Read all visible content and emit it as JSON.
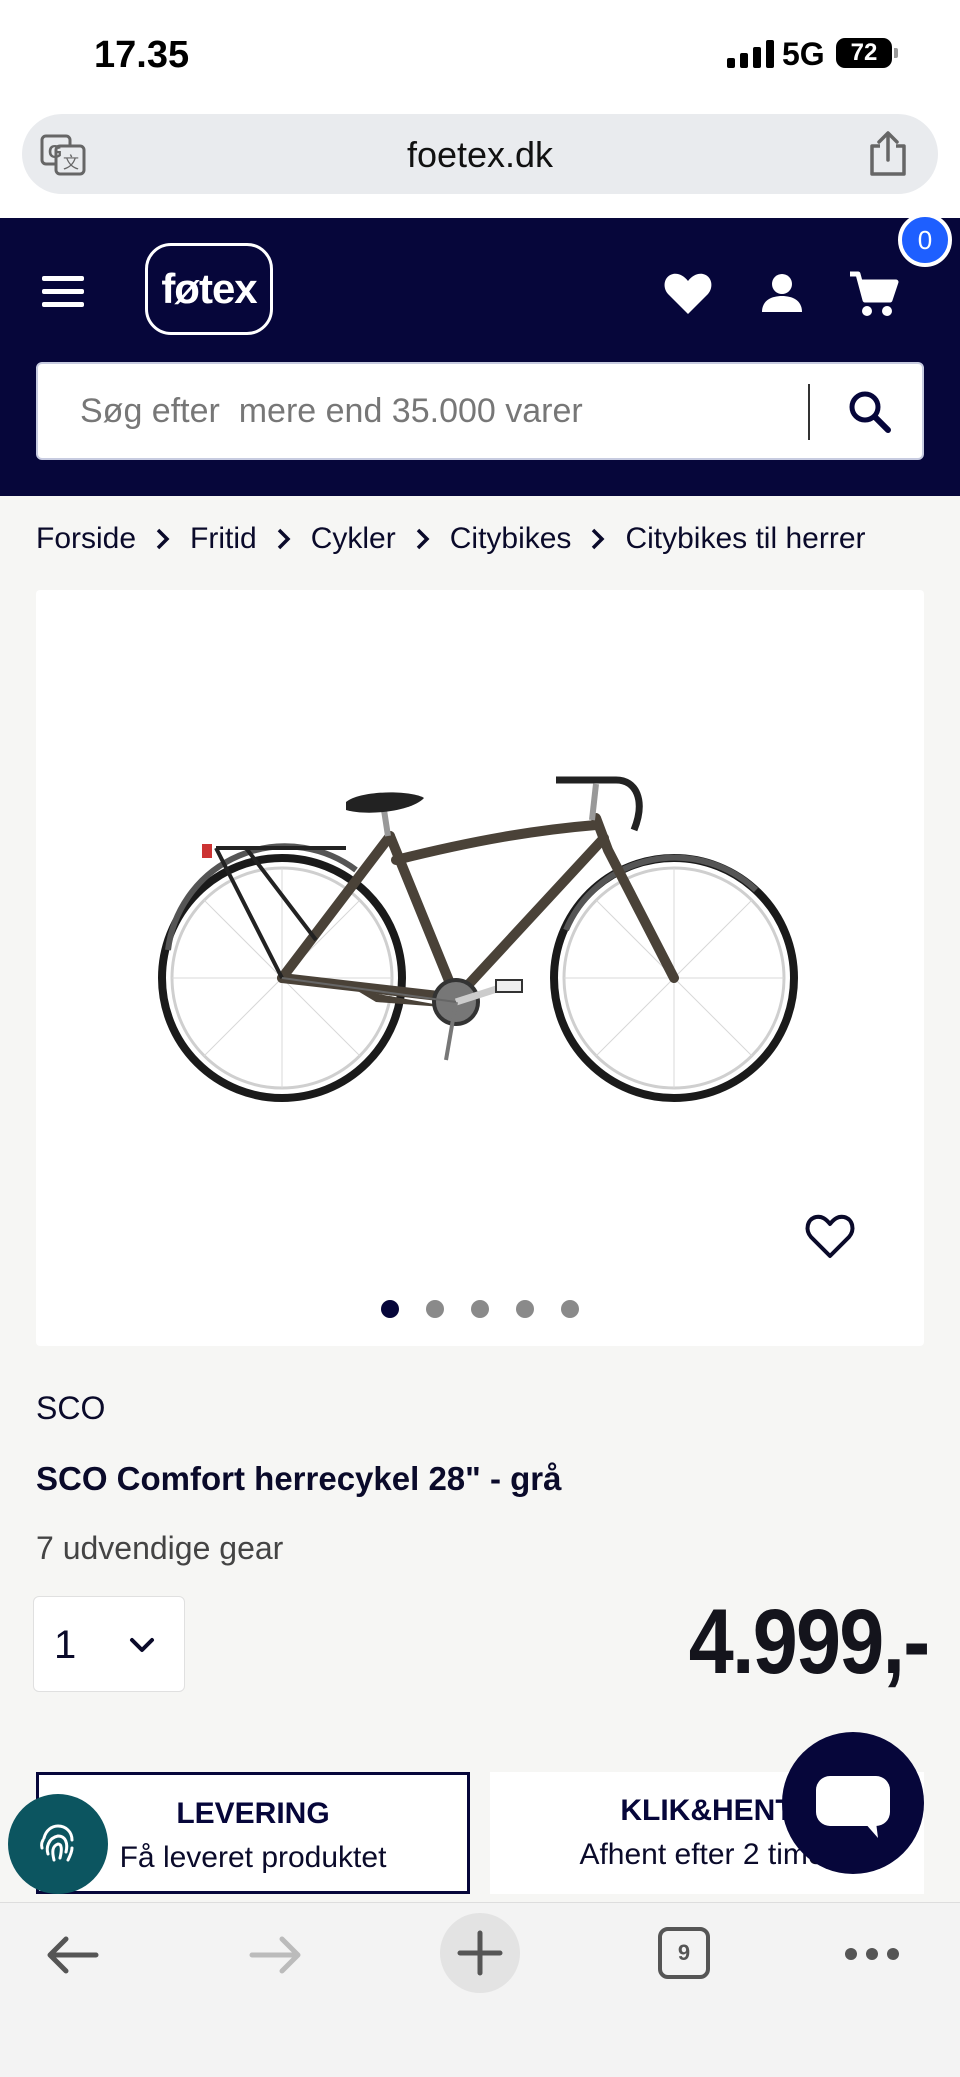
{
  "status_bar": {
    "time": "17.35",
    "network": "5G",
    "battery": "72"
  },
  "browser": {
    "url": "foetex.dk",
    "tab_count": "9"
  },
  "header": {
    "logo": "føtex",
    "cart_count": "0",
    "search_placeholder": "Søg efter  mere end 35.000 varer"
  },
  "breadcrumb": [
    "Forside",
    "Fritid",
    "Cykler",
    "Citybikes",
    "Citybikes til herrer"
  ],
  "gallery": {
    "image_count": 5,
    "active_index": 0
  },
  "product": {
    "brand": "SCO",
    "title": "SCO Comfort herrecykel 28\" - grå",
    "subtitle": "7 udvendige gear",
    "quantity": "1",
    "price": "4.999,-"
  },
  "delivery_options": [
    {
      "heading": "LEVERING",
      "text": "Få leveret produktet",
      "selected": true
    },
    {
      "heading": "KLIK&HENT",
      "text": "Afhent efter 2 timer",
      "selected": false
    }
  ],
  "colors": {
    "brand_navy": "#06063a",
    "badge_blue": "#1e5fff",
    "fingerprint_teal": "#0c5560"
  }
}
